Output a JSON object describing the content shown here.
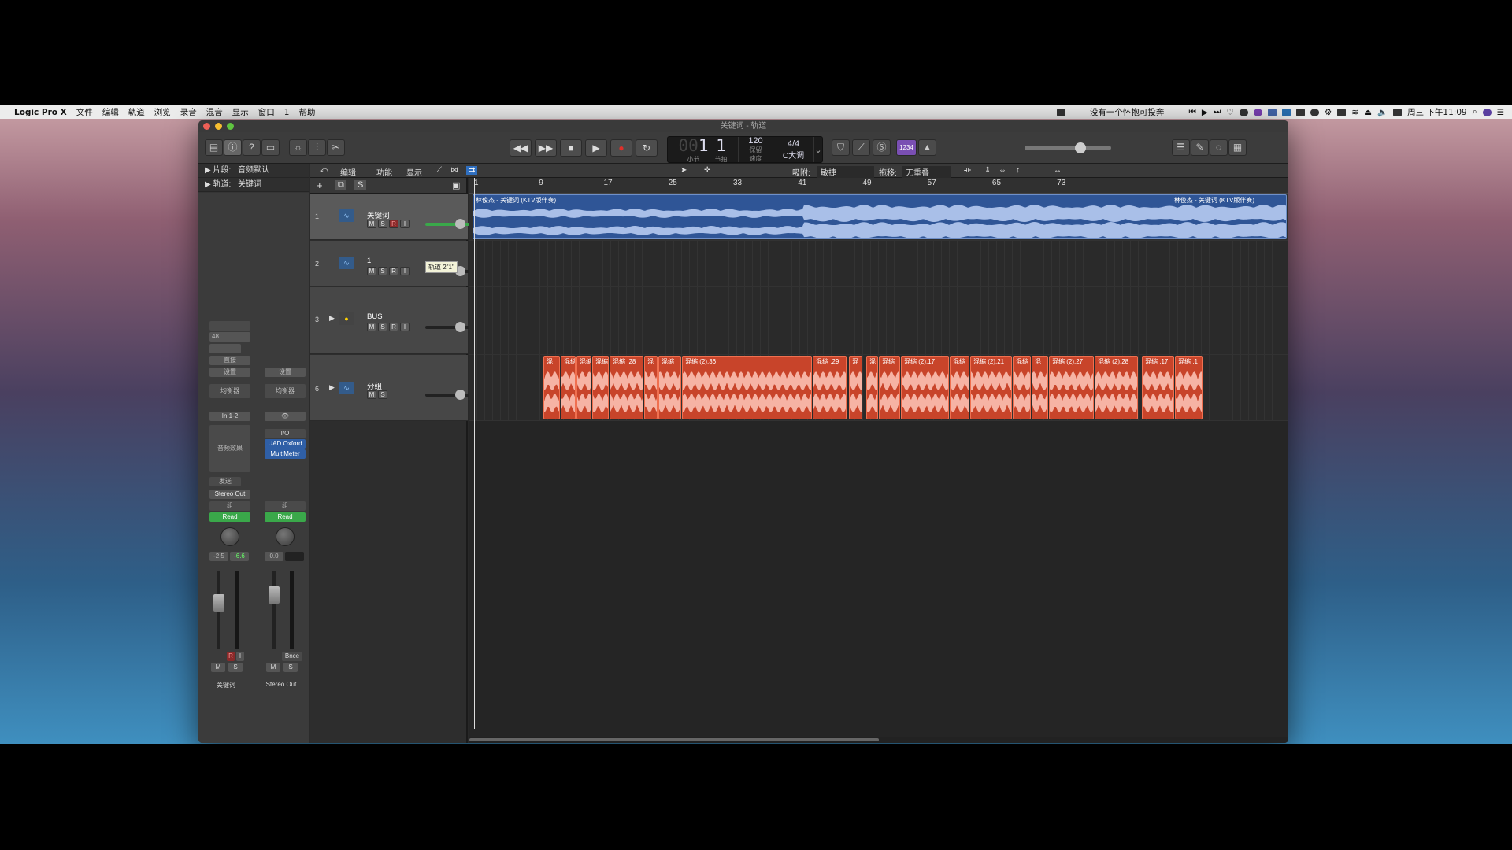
{
  "menubar": {
    "apple": "",
    "items": [
      "Logic Pro X",
      "文件",
      "编辑",
      "轨道",
      "浏览",
      "录音",
      "混音",
      "显示",
      "窗口",
      "1",
      "帮助"
    ],
    "status_text": "没有一个怀抱可投奔",
    "clock": "周三 下午11:09"
  },
  "window": {
    "title": "关键词 - 轨道"
  },
  "lcd": {
    "bar_dim": "00",
    "bar": "1",
    "beat": "1",
    "bar_label": "小节",
    "beat_label": "节拍",
    "tempo": "120",
    "tempo_label": "保留",
    "tempo_sub": "速度",
    "timesig": "4/4",
    "key": "C大调"
  },
  "toolbar": {
    "count_in": "1234"
  },
  "inspector": {
    "region_label": "片段:",
    "region_value": "音频默认",
    "track_label": "轨道:",
    "track_value": "关键词"
  },
  "strip1": {
    "setting": "设置",
    "direct": "直接",
    "eq": "均衡器",
    "input": "In 1-2",
    "fx": "音频效果",
    "send": "发送",
    "output": "Stereo Out",
    "group": "组",
    "automation": "Read",
    "vol": "-2.5",
    "peak": "-6.6",
    "gain": "48",
    "m": "M",
    "s": "S",
    "r": "R",
    "i": "I",
    "name": "关键词"
  },
  "strip2": {
    "setting": "设置",
    "eq": "均衡器",
    "io": "I/O",
    "plugin1": "UAD Oxford",
    "plugin2": "MultiMeter",
    "group": "组",
    "automation": "Read",
    "vol": "0.0",
    "bnce": "Bnce",
    "m": "M",
    "s": "S",
    "name": "Stereo Out"
  },
  "localbar": {
    "edit": "编辑",
    "func": "功能",
    "view": "显示",
    "snap_label": "吸附:",
    "snap_value": "敏捷",
    "drag_label": "拖移:",
    "drag_value": "无重叠"
  },
  "tracks": [
    {
      "num": "1",
      "name": "关键词"
    },
    {
      "num": "2",
      "name": "1"
    },
    {
      "num": "3",
      "name": "BUS"
    },
    {
      "num": "6",
      "name": "分组"
    }
  ],
  "track_buttons": {
    "m": "M",
    "s": "S",
    "r": "R",
    "i": "I"
  },
  "tooltip": "轨道 2\"1\"",
  "header_s": "S",
  "ruler": [
    "1",
    "9",
    "17",
    "25",
    "33",
    "41",
    "49",
    "57",
    "65",
    "73"
  ],
  "regions": {
    "blue_left": "林俊杰 - 关键词 (KTV版伴奏)",
    "blue_right": "林俊杰 - 关键词 (KTV版伴奏)",
    "red": [
      "混",
      "混缩",
      "混缩",
      "混缩",
      "混缩 .28",
      "混",
      "混缩",
      "混缩 (2).36",
      "混缩 .29",
      "混",
      "混",
      "混缩",
      "混缩 (2).17",
      "混缩",
      "混缩 (2).21",
      "混缩",
      "混",
      "混缩 (2).27",
      "混缩 (2).28",
      "混缩 .17",
      "混缩 .1"
    ]
  },
  "colors": {
    "blue_region": "#2f5596",
    "red_region": "#c8442a",
    "automation_read": "#3aa84a",
    "record": "#d0302a",
    "count_in": "#7a4fb3"
  }
}
